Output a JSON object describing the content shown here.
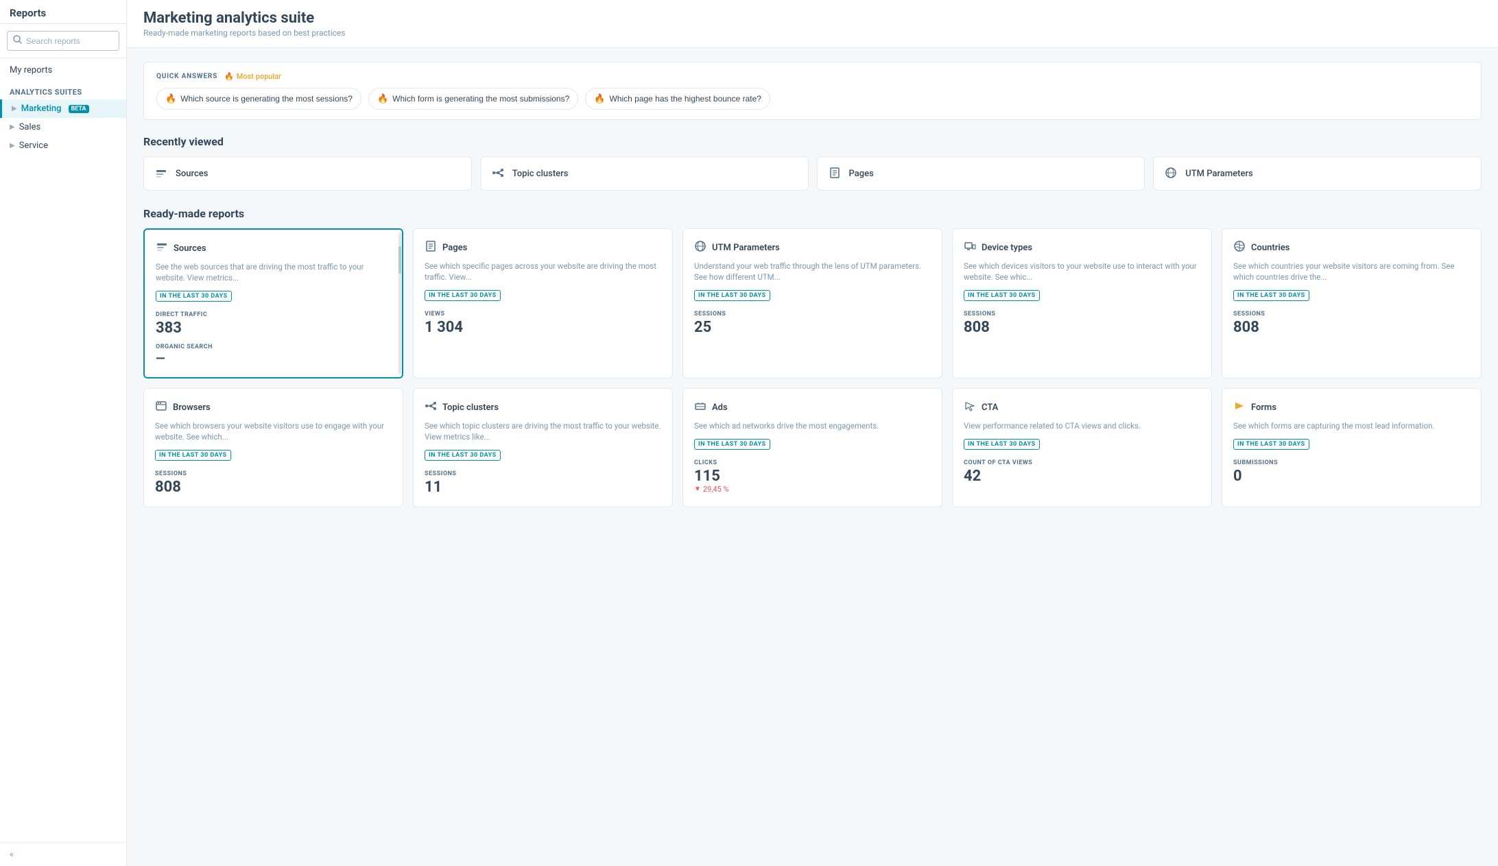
{
  "app": {
    "title": "Reports"
  },
  "sidebar": {
    "search_placeholder": "Search reports",
    "my_reports": "My reports",
    "analytics_suites_label": "Analytics suites",
    "nav_items": [
      {
        "id": "marketing",
        "label": "Marketing",
        "badge": "BETA",
        "active": true
      },
      {
        "id": "sales",
        "label": "Sales",
        "active": false
      },
      {
        "id": "service",
        "label": "Service",
        "active": false
      }
    ],
    "collapse_label": "«"
  },
  "main": {
    "header": {
      "title": "Marketing analytics suite",
      "subtitle": "Ready-made marketing reports based on best practices"
    },
    "quick_answers": {
      "label": "QUICK ANSWERS",
      "most_popular": "Most popular",
      "items": [
        "Which source is generating the most sessions?",
        "Which form is generating the most submissions?",
        "Which page has the highest bounce rate?"
      ]
    },
    "recently_viewed": {
      "title": "Recently viewed",
      "cards": [
        {
          "id": "sources",
          "label": "Sources"
        },
        {
          "id": "topic-clusters",
          "label": "Topic clusters"
        },
        {
          "id": "pages",
          "label": "Pages"
        },
        {
          "id": "utm-parameters",
          "label": "UTM Parameters"
        }
      ]
    },
    "ready_made_reports": {
      "title": "Ready-made reports",
      "cards": [
        {
          "id": "sources",
          "title": "Sources",
          "description": "See the web sources that are driving the most traffic to your website. View metrics...",
          "badge": "IN THE LAST 30 DAYS",
          "metrics": [
            {
              "label": "DIRECT TRAFFIC",
              "value": "383"
            },
            {
              "label": "ORGANIC SEARCH",
              "value": "—"
            }
          ],
          "highlighted": true
        },
        {
          "id": "pages",
          "title": "Pages",
          "description": "See which specific pages across your website are driving the most traffic. View...",
          "badge": "IN THE LAST 30 DAYS",
          "metrics": [
            {
              "label": "VIEWS",
              "value": "1 304"
            }
          ],
          "highlighted": false
        },
        {
          "id": "utm-parameters",
          "title": "UTM Parameters",
          "description": "Understand your web traffic through the lens of UTM parameters. See how different UTM...",
          "badge": "IN THE LAST 30 DAYS",
          "metrics": [
            {
              "label": "SESSIONS",
              "value": "25"
            }
          ],
          "highlighted": false
        },
        {
          "id": "device-types",
          "title": "Device types",
          "description": "See which devices visitors to your website use to interact with your website. See whic...",
          "badge": "IN THE LAST 30 DAYS",
          "metrics": [
            {
              "label": "SESSIONS",
              "value": "808"
            }
          ],
          "highlighted": false
        },
        {
          "id": "countries",
          "title": "Countries",
          "description": "See which countries your website visitors are coming from. See which countries drive the...",
          "badge": "IN THE LAST 30 DAYS",
          "metrics": [
            {
              "label": "SESSIONS",
              "value": "808"
            }
          ],
          "highlighted": false
        },
        {
          "id": "browsers",
          "title": "Browsers",
          "description": "See which browsers your website visitors use to engage with your website. See which...",
          "badge": "IN THE LAST 30 DAYS",
          "metrics": [
            {
              "label": "SESSIONS",
              "value": "808"
            }
          ],
          "highlighted": false
        },
        {
          "id": "topic-clusters",
          "title": "Topic clusters",
          "description": "See which topic clusters are driving the most traffic to your website. View metrics like...",
          "badge": "IN THE LAST 30 DAYS",
          "metrics": [
            {
              "label": "SESSIONS",
              "value": "11"
            }
          ],
          "highlighted": false
        },
        {
          "id": "ads",
          "title": "Ads",
          "description": "See which ad networks drive the most engagements.",
          "badge": "IN THE LAST 30 DAYS",
          "metrics": [
            {
              "label": "CLICKS",
              "value": "115",
              "change": "29,45 %",
              "change_dir": "down"
            }
          ],
          "highlighted": false
        },
        {
          "id": "cta",
          "title": "CTA",
          "description": "View performance related to CTA views and clicks.",
          "badge": "IN THE LAST 30 DAYS",
          "metrics": [
            {
              "label": "COUNT OF CTA VIEWS",
              "value": "42"
            }
          ],
          "highlighted": false
        },
        {
          "id": "forms",
          "title": "Forms",
          "description": "See which forms are capturing the most lead information.",
          "badge": "IN THE LAST 30 DAYS",
          "metrics": [
            {
              "label": "SUBMISSIONS",
              "value": "0"
            }
          ],
          "highlighted": false
        }
      ]
    }
  },
  "icons": {
    "sources_color": "#516f90",
    "topic_color": "#516f90",
    "pages_color": "#516f90",
    "utm_color": "#516f90",
    "device_color": "#516f90",
    "countries_color": "#516f90",
    "browsers_color": "#516f90",
    "ads_color": "#516f90",
    "cta_color": "#516f90",
    "forms_color": "#f5a623"
  }
}
